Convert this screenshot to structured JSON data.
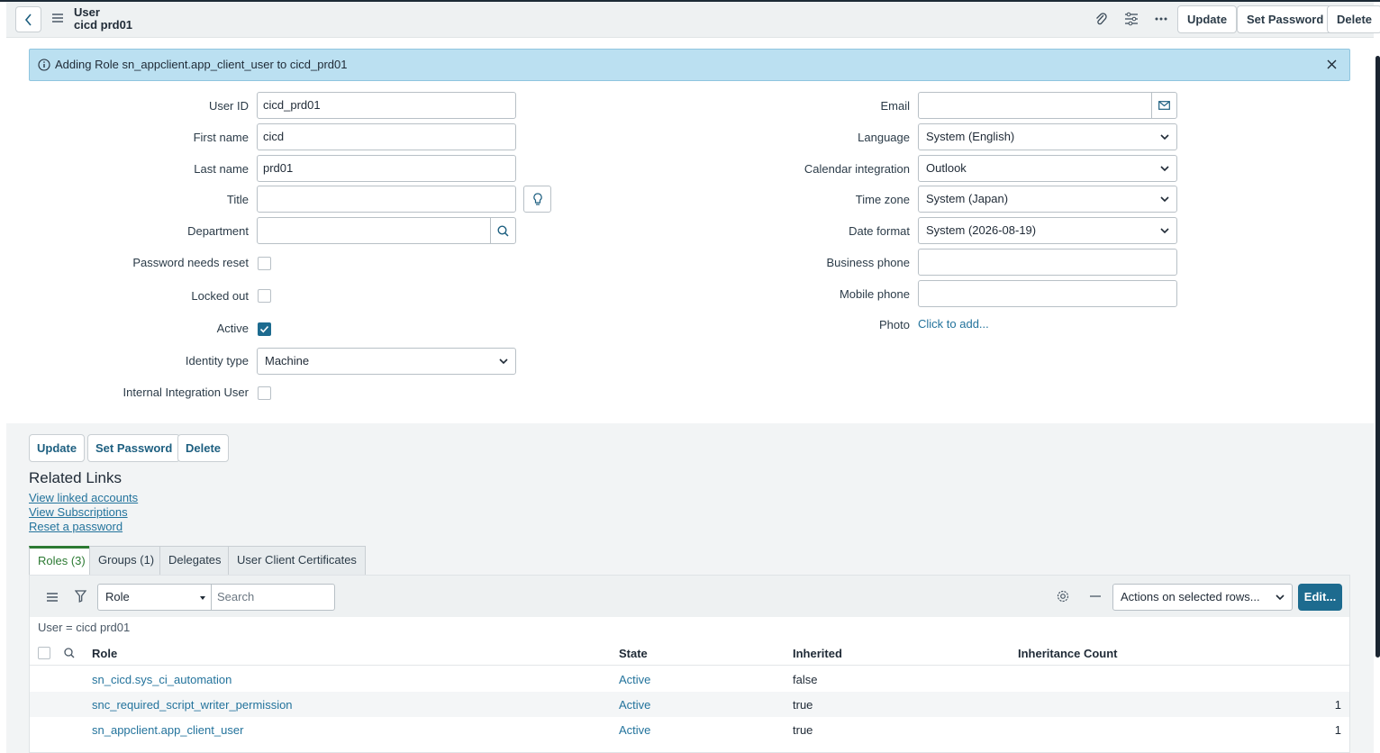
{
  "header": {
    "record_type": "User",
    "record_name": "cicd prd01",
    "buttons": {
      "update": "Update",
      "set_password": "Set Password",
      "delete": "Delete"
    }
  },
  "banner": {
    "message": "Adding Role sn_appclient.app_client_user to cicd_prd01"
  },
  "form": {
    "user_id": {
      "label": "User ID",
      "value": "cicd_prd01"
    },
    "first_name": {
      "label": "First name",
      "value": "cicd"
    },
    "last_name": {
      "label": "Last name",
      "value": "prd01"
    },
    "title": {
      "label": "Title",
      "value": ""
    },
    "department": {
      "label": "Department",
      "value": ""
    },
    "password_needs_reset": {
      "label": "Password needs reset",
      "checked": false
    },
    "locked_out": {
      "label": "Locked out",
      "checked": false
    },
    "active": {
      "label": "Active",
      "checked": true
    },
    "identity_type": {
      "label": "Identity type",
      "value": "Machine"
    },
    "internal_integration_user": {
      "label": "Internal Integration User",
      "checked": false
    },
    "email": {
      "label": "Email",
      "value": ""
    },
    "language": {
      "label": "Language",
      "value": "System (English)"
    },
    "calendar_integration": {
      "label": "Calendar integration",
      "value": "Outlook"
    },
    "time_zone": {
      "label": "Time zone",
      "value": "System (Japan)"
    },
    "date_format": {
      "label": "Date format",
      "value": "System (2026-08-19)"
    },
    "business_phone": {
      "label": "Business phone",
      "value": ""
    },
    "mobile_phone": {
      "label": "Mobile phone",
      "value": ""
    },
    "photo": {
      "label": "Photo",
      "value": "Click to add..."
    }
  },
  "form_buttons": {
    "update": "Update",
    "set_password": "Set Password",
    "delete": "Delete"
  },
  "related_links": {
    "title": "Related Links",
    "links": [
      "View linked accounts",
      "View Subscriptions",
      "Reset a password"
    ]
  },
  "tabs": [
    "Roles (3)",
    "Groups (1)",
    "Delegates",
    "User Client Certificates"
  ],
  "list": {
    "search_field": "Role",
    "search_placeholder": "Search",
    "actions_select": "Actions on selected rows...",
    "edit_button": "Edit...",
    "breadcrumb": "User = cicd prd01",
    "columns": [
      "Role",
      "State",
      "Inherited",
      "Inheritance Count"
    ],
    "rows": [
      {
        "role": "sn_cicd.sys_ci_automation",
        "state": "Active",
        "inherited": "false",
        "count": ""
      },
      {
        "role": "snc_required_script_writer_permission",
        "state": "Active",
        "inherited": "true",
        "count": "1"
      },
      {
        "role": "sn_appclient.app_client_user",
        "state": "Active",
        "inherited": "true",
        "count": "1"
      }
    ]
  },
  "colors": {
    "accent": "#1d6b8f",
    "link": "#23739c",
    "banner": "#bbe0f1",
    "active_tab": "#2c7a33",
    "edit_button": "#1d6b8f"
  }
}
